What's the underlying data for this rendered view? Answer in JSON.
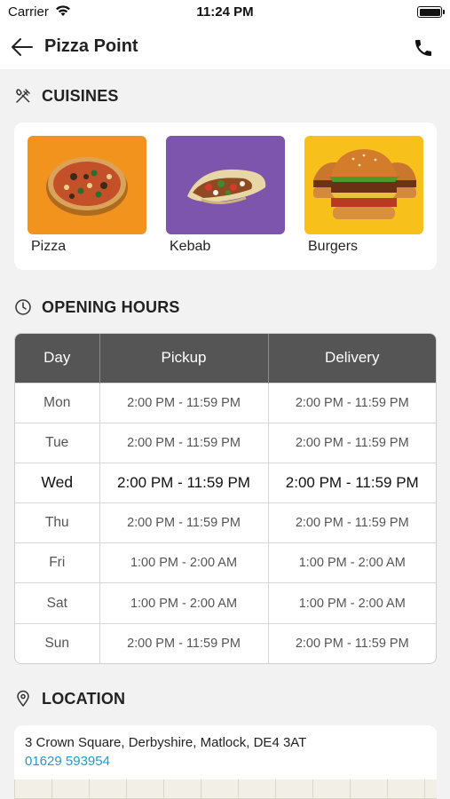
{
  "status_bar": {
    "carrier": "Carrier",
    "time": "11:24 PM"
  },
  "nav": {
    "title": "Pizza Point"
  },
  "sections": {
    "cuisines": "CUISINES",
    "opening_hours": "OPENING HOURS",
    "location": "LOCATION"
  },
  "cuisines": [
    {
      "label": "Pizza",
      "color": "#f2931e",
      "icon": "pizza-image"
    },
    {
      "label": "Kebab",
      "color": "#7d55ad",
      "icon": "kebab-image"
    },
    {
      "label": "Burgers",
      "color": "#f8c01a",
      "icon": "burger-image"
    }
  ],
  "hours": {
    "headers": [
      "Day",
      "Pickup",
      "Delivery"
    ],
    "today": "Wed",
    "rows": [
      {
        "day": "Mon",
        "pickup": "2:00 PM - 11:59 PM",
        "delivery": "2:00 PM - 11:59 PM"
      },
      {
        "day": "Tue",
        "pickup": "2:00 PM - 11:59 PM",
        "delivery": "2:00 PM - 11:59 PM"
      },
      {
        "day": "Wed",
        "pickup": "2:00 PM - 11:59 PM",
        "delivery": "2:00 PM - 11:59 PM"
      },
      {
        "day": "Thu",
        "pickup": "2:00 PM - 11:59 PM",
        "delivery": "2:00 PM - 11:59 PM"
      },
      {
        "day": "Fri",
        "pickup": "1:00 PM - 2:00 AM",
        "delivery": "1:00 PM - 2:00 AM"
      },
      {
        "day": "Sat",
        "pickup": "1:00 PM - 2:00 AM",
        "delivery": "1:00 PM - 2:00 AM"
      },
      {
        "day": "Sun",
        "pickup": "2:00 PM - 11:59 PM",
        "delivery": "2:00 PM - 11:59 PM"
      }
    ]
  },
  "location": {
    "address": "3 Crown Square, Derbyshire, Matlock, DE4 3AT",
    "phone": "01629 593954"
  },
  "colors": {
    "table_header": "#555555",
    "link": "#2a97c9",
    "background": "#f2f2f2"
  }
}
